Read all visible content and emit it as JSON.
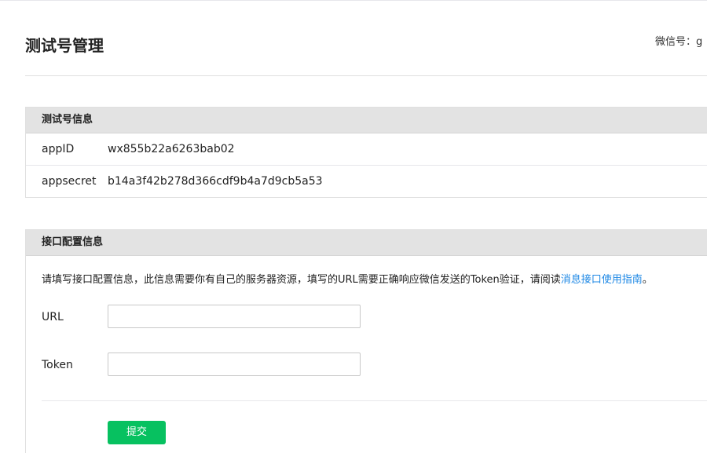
{
  "header": {
    "title": "测试号管理",
    "wechat_id_label": "微信号：",
    "wechat_id_value": "g"
  },
  "test_account_panel": {
    "title": "测试号信息",
    "rows": [
      {
        "label": "appID",
        "value": "wx855b22a6263bab02"
      },
      {
        "label": "appsecret",
        "value": "b14a3f42b278d366cdf9b4a7d9cb5a53"
      }
    ]
  },
  "interface_panel": {
    "title": "接口配置信息",
    "description_prefix": "请填写接口配置信息，此信息需要你有自己的服务器资源，填写的URL需要正确响应微信发送的Token验证，请阅读",
    "description_link": "消息接口使用指南",
    "description_suffix": "。",
    "url_label": "URL",
    "url_value": "",
    "token_label": "Token",
    "token_value": "",
    "submit_label": "提交"
  },
  "colors": {
    "accent": "#07c160",
    "link": "#1e88e5",
    "panel_header_bg": "#e3e3e3"
  }
}
